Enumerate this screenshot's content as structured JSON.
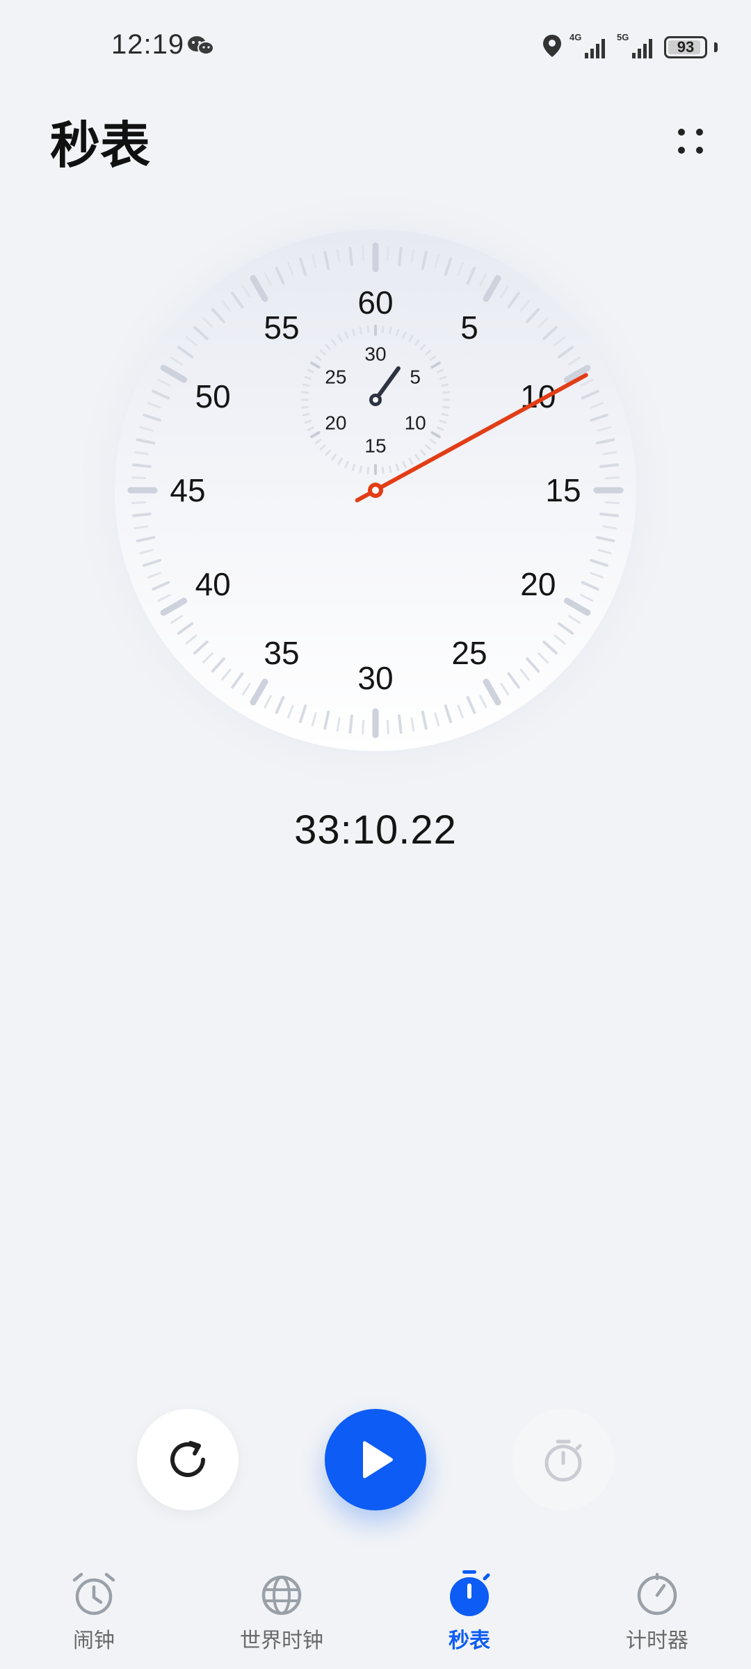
{
  "status_bar": {
    "time": "12:19",
    "network_left": "4G",
    "network_right": "5G",
    "battery_level": "93",
    "icons": [
      "wechat-icon",
      "location-icon",
      "signal-icon",
      "battery-icon"
    ]
  },
  "header": {
    "title": "秒表",
    "more_icon": "more-dots-icon"
  },
  "dial": {
    "outer_labels": [
      "60",
      "5",
      "10",
      "15",
      "20",
      "25",
      "30",
      "35",
      "40",
      "45",
      "50",
      "55"
    ],
    "inner_labels": [
      "30",
      "5",
      "10",
      "15",
      "20",
      "25"
    ],
    "second_hand_seconds": 10.22,
    "minute_hand_minutes": 3,
    "hand_color": "#e23d16"
  },
  "elapsed_time": "33:10.22",
  "controls": {
    "reset_icon": "reset-icon",
    "start_icon": "play-icon",
    "lap_icon": "stopwatch-icon",
    "start_color": "#0c5cf5"
  },
  "tabs": [
    {
      "label": "闹钟",
      "icon": "alarm-icon",
      "active": false
    },
    {
      "label": "世界时钟",
      "icon": "globe-icon",
      "active": false
    },
    {
      "label": "秒表",
      "icon": "stopwatch-icon",
      "active": true
    },
    {
      "label": "计时器",
      "icon": "timer-icon",
      "active": false
    }
  ],
  "accent_color": "#0c5cf5"
}
